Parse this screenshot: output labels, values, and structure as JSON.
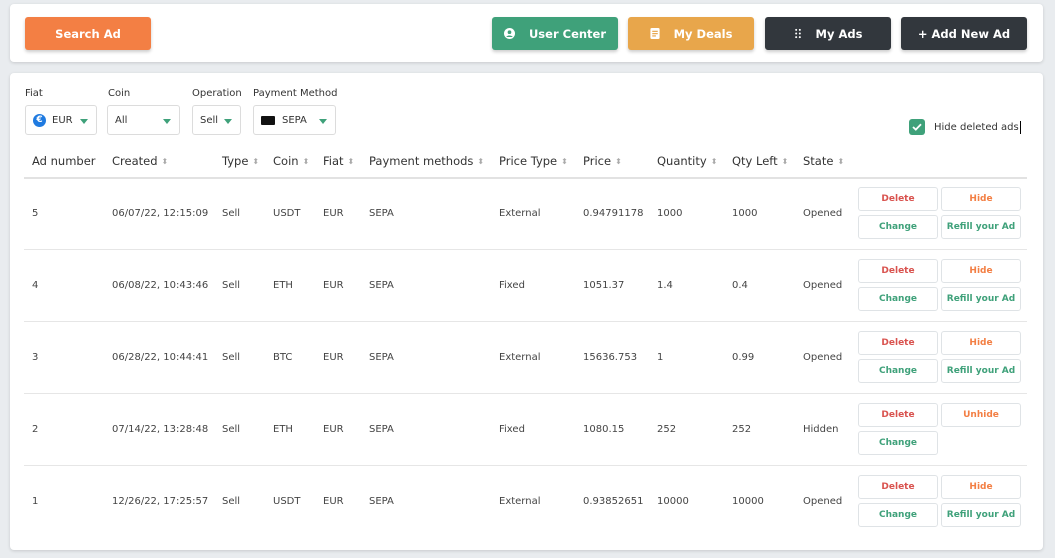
{
  "toolbar": {
    "search_ad": "Search Ad",
    "user_center": "User Center",
    "my_deals": "My Deals",
    "my_ads": "My Ads",
    "add_new_ad": "+ Add New Ad"
  },
  "filters": {
    "fiat": {
      "label": "Fiat",
      "value": "EUR"
    },
    "coin": {
      "label": "Coin",
      "value": "All"
    },
    "operation": {
      "label": "Operation",
      "value": "Sell"
    },
    "payment": {
      "label": "Payment Method",
      "value": "SEPA"
    },
    "hide_deleted": {
      "label": "Hide deleted ads",
      "checked": true
    }
  },
  "table": {
    "headers": [
      "Ad number",
      "Created",
      "Type",
      "Coin",
      "Fiat",
      "Payment methods",
      "Price Type",
      "Price",
      "Quantity",
      "Qty Left",
      "State"
    ],
    "actions": {
      "delete": "Delete",
      "hide": "Hide",
      "unhide": "Unhide",
      "change": "Change",
      "refill": "Refill your Ad"
    },
    "rows": [
      {
        "ad": "5",
        "created": "06/07/22, 12:15:09",
        "type": "Sell",
        "coin": "USDT",
        "fiat": "EUR",
        "pm": "SEPA",
        "ptype": "External",
        "price": "0.94791178",
        "qty": "1000",
        "left": "1000",
        "state": "Opened"
      },
      {
        "ad": "4",
        "created": "06/08/22, 10:43:46",
        "type": "Sell",
        "coin": "ETH",
        "fiat": "EUR",
        "pm": "SEPA",
        "ptype": "Fixed",
        "price": "1051.37",
        "qty": "1.4",
        "left": "0.4",
        "state": "Opened"
      },
      {
        "ad": "3",
        "created": "06/28/22, 10:44:41",
        "type": "Sell",
        "coin": "BTC",
        "fiat": "EUR",
        "pm": "SEPA",
        "ptype": "External",
        "price": "15636.753",
        "qty": "1",
        "left": "0.99",
        "state": "Opened"
      },
      {
        "ad": "2",
        "created": "07/14/22, 13:28:48",
        "type": "Sell",
        "coin": "ETH",
        "fiat": "EUR",
        "pm": "SEPA",
        "ptype": "Fixed",
        "price": "1080.15",
        "qty": "252",
        "left": "252",
        "state": "Hidden"
      },
      {
        "ad": "1",
        "created": "12/26/22, 17:25:57",
        "type": "Sell",
        "coin": "USDT",
        "fiat": "EUR",
        "pm": "SEPA",
        "ptype": "External",
        "price": "0.93852651",
        "qty": "10000",
        "left": "10000",
        "state": "Opened"
      }
    ]
  }
}
